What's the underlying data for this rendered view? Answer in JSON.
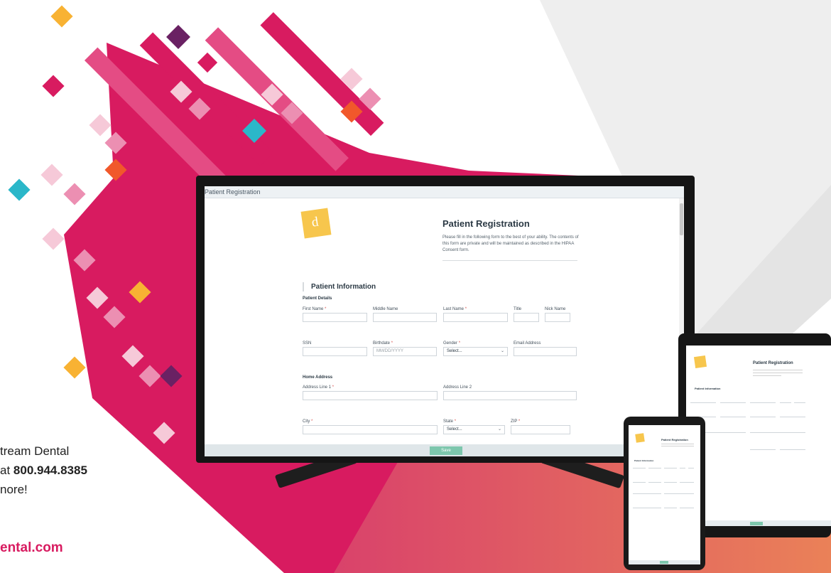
{
  "colors": {
    "magenta": "#d81b60",
    "orange": "#f1582b",
    "yellow": "#f8b233",
    "teal": "#2bb7c9",
    "purple": "#6a2163",
    "pink_light": "#f6c9d8",
    "coral": "#e9735c",
    "accent_green": "#7dc7ad",
    "logo_yellow": "#f7c64d"
  },
  "window": {
    "title": "Patient Registration"
  },
  "logo": {
    "letter": "d"
  },
  "form": {
    "title": "Patient Registration",
    "intro": "Please fill in the following form to the best of your ability. The contents of this form are private and will be maintained as described in the HIPAA Consent form.",
    "section_title": "Patient Information",
    "details_title": "Patient Details",
    "home_address_title": "Home Address",
    "required_mark": "*",
    "fields": {
      "first_name": "First Name",
      "middle_name": "Middle Name",
      "last_name": "Last Name",
      "title": "Title",
      "nick_name": "Nick Name",
      "ssn": "SSN",
      "birthdate": "Birthdate",
      "birthdate_placeholder": "MM/DD/YYYY",
      "gender": "Gender",
      "gender_value": "Select...",
      "email": "Email Address",
      "address1": "Address Line 1",
      "address2": "Address Line 2",
      "city": "City",
      "state": "State",
      "state_value": "Select...",
      "zip": "ZIP"
    },
    "submit_label": "Save"
  },
  "side_copy": {
    "line1": "tream Dental",
    "line2_prefix": "at ",
    "phone": "800.944.8385",
    "line3": "nore!",
    "url": "ental.com"
  },
  "icons": {
    "dropdown": "chevron-down-icon"
  },
  "chevron_glyph": "⌄"
}
